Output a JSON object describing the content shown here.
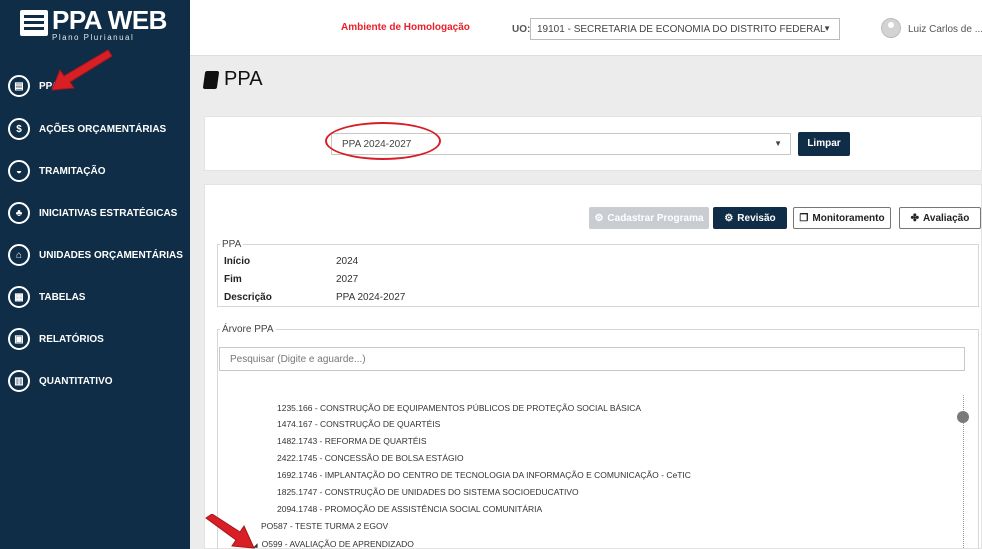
{
  "app": {
    "logo_title": "PPA WEB",
    "logo_subtitle": "Plano Plurianual"
  },
  "sidebar": {
    "items": [
      {
        "label": "PPA",
        "icon": "book-icon",
        "glyph": "▤"
      },
      {
        "label": "AÇÕES ORÇAMENTÁRIAS",
        "icon": "dollar-icon",
        "glyph": "$"
      },
      {
        "label": "TRAMITAÇÃO",
        "icon": "inbox-icon",
        "glyph": "◒"
      },
      {
        "label": "INICIATIVAS ESTRATÉGICAS",
        "icon": "sitemap-icon",
        "glyph": "♣"
      },
      {
        "label": "UNIDADES ORÇAMENTÁRIAS",
        "icon": "bank-icon",
        "glyph": "⌂"
      },
      {
        "label": "TABELAS",
        "icon": "table-icon",
        "glyph": "▦"
      },
      {
        "label": "RELATÓRIOS",
        "icon": "file-icon",
        "glyph": "▣"
      },
      {
        "label": "QUANTITATIVO",
        "icon": "bar-chart-icon",
        "glyph": "▥"
      }
    ]
  },
  "topbar": {
    "environment": "Ambiente de Homologação",
    "uo_label": "UO:",
    "uo_value": "19101 - SECRETARIA DE ECONOMIA DO DISTRITO FEDERAL",
    "user_name": "Luiz Carlos de ..."
  },
  "page": {
    "title": "PPA"
  },
  "ppa_select": {
    "value": "PPA 2024-2027",
    "clear_label": "Limpar"
  },
  "actions": {
    "cadastrar": "Cadastrar Programa",
    "revisao": "Revisão",
    "monitoramento": "Monitoramento",
    "avaliacao": "Avaliação"
  },
  "ppa_info": {
    "legend": "PPA",
    "rows": [
      {
        "key": "Início",
        "value": "2024"
      },
      {
        "key": "Fim",
        "value": "2027"
      },
      {
        "key": "Descrição",
        "value": "PPA 2024-2027"
      }
    ]
  },
  "tree": {
    "legend": "Árvore PPA",
    "search_placeholder": "Pesquisar (Digite e aguarde...)",
    "items": [
      "1235.166 - CONSTRUÇÃO DE EQUIPAMENTOS PÚBLICOS DE PROTEÇÃO SOCIAL BÁSICA",
      "1474.167 - CONSTRUÇÃO DE QUARTÉIS",
      "1482.1743 - REFORMA DE QUARTÉIS",
      "2422.1745 - CONCESSÃO DE BOLSA ESTÁGIO",
      "1692.1746 - IMPLANTAÇÃO DO CENTRO DE TECNOLOGIA DA INFORMAÇÃO E COMUNICAÇÃO - CeTIC",
      "1825.1747 - CONSTRUÇÃO DE UNIDADES DO SISTEMA SOCIOEDUCATIVO",
      "2094.1748 - PROMOÇÃO DE ASSISTÊNCIA SOCIAL COMUNITÁRIA",
      "PO587 - TESTE TURMA 2 EGOV",
      "O599 - AVALIAÇÃO DE APRENDIZADO"
    ]
  },
  "colors": {
    "sidebar": "#0f2d46",
    "annotation_red": "#d81f26",
    "environment_red": "#e8202a"
  }
}
